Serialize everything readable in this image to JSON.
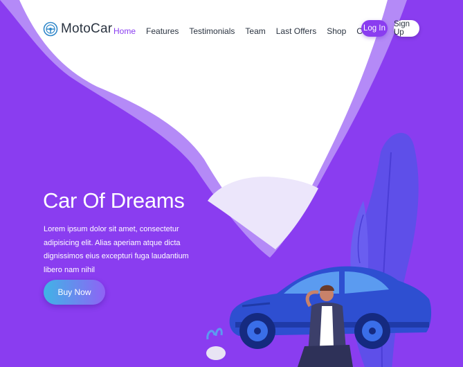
{
  "brand": {
    "name": "MotoCar",
    "icon": "steering-wheel-icon"
  },
  "nav": {
    "items": [
      {
        "label": "Home",
        "active": true
      },
      {
        "label": "Features",
        "active": false
      },
      {
        "label": "Testimonials",
        "active": false
      },
      {
        "label": "Team",
        "active": false
      },
      {
        "label": "Last Offers",
        "active": false
      },
      {
        "label": "Shop",
        "active": false
      },
      {
        "label": "Contact",
        "active": false
      }
    ],
    "login_label": "Log In",
    "signup_label": "Sign Up"
  },
  "hero": {
    "title": "Car Of Dreams",
    "text": "Lorem ipsum dolor sit amet, consectetur adipisicing elit. Alias aperiam atque dicta dignissimos eius excepturi fuga laudantium libero nam nihil",
    "button_label": "Buy Now"
  },
  "colors": {
    "primary": "#8a3df0",
    "wave_light": "#b48af7",
    "text_dark": "#2a3340",
    "car_blue": "#2e4fd1"
  }
}
